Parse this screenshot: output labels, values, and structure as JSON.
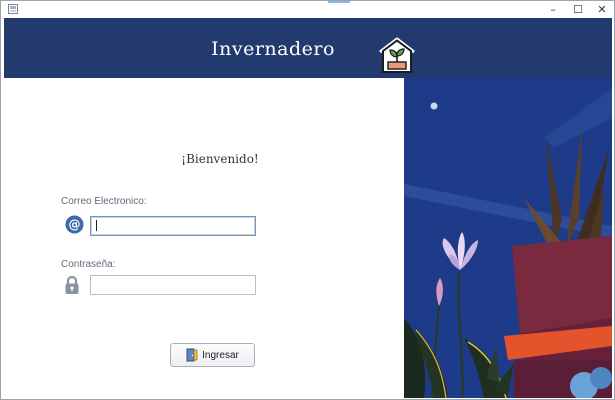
{
  "window": {
    "controls": {
      "minimize": "–",
      "maximize": "☐",
      "close": "✕"
    }
  },
  "header": {
    "title": "Invernadero",
    "icon": "greenhouse-icon",
    "background": "#223a6e"
  },
  "login": {
    "welcome": "¡Bienvenido!",
    "email_label": "Correo Electronico:",
    "email_value": "",
    "password_label": "Contraseña:",
    "password_value": "",
    "submit_label": "Ingresar"
  },
  "icons": {
    "email": "at-sign-icon",
    "password": "padlock-icon",
    "submit": "door-exit-icon"
  },
  "colors": {
    "header": "#223a6e",
    "scene_sky": "#1c3a86",
    "accent_blue": "#3f6aa8"
  }
}
